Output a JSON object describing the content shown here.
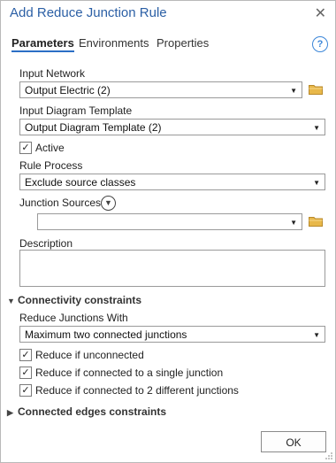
{
  "window": {
    "title": "Add Reduce Junction Rule"
  },
  "tabs": [
    "Parameters",
    "Environments",
    "Properties"
  ],
  "fields": {
    "input_network": {
      "label": "Input Network",
      "value": "Output Electric (2)"
    },
    "input_diagram_template": {
      "label": "Input Diagram Template",
      "value": "Output Diagram Template (2)"
    },
    "active": {
      "label": "Active",
      "checked": true
    },
    "rule_process": {
      "label": "Rule Process",
      "value": "Exclude source classes"
    },
    "junction_sources": {
      "label": "Junction Sources",
      "value": ""
    },
    "description": {
      "label": "Description",
      "value": ""
    }
  },
  "connectivity": {
    "title": "Connectivity constraints",
    "reduce_with": {
      "label": "Reduce Junctions With",
      "value": "Maximum two connected junctions"
    },
    "checkboxes": [
      {
        "label": "Reduce if unconnected",
        "checked": true
      },
      {
        "label": "Reduce if connected to a single junction",
        "checked": true
      },
      {
        "label": "Reduce if connected to 2 different junctions",
        "checked": true
      }
    ]
  },
  "connected_edges": {
    "title": "Connected edges constraints"
  },
  "buttons": {
    "ok": "OK"
  },
  "icons": {
    "close": "close-icon",
    "help": "help-icon",
    "folder": "folder-icon",
    "dropdown": "chevron-down-icon",
    "expand": "chevron-circle-down-icon",
    "section_collapse": "chevron-down-icon",
    "section_expand": "chevron-right-icon"
  },
  "colors": {
    "accent": "#2b6fc5",
    "title": "#2b5fa5",
    "folder": "#e8b84a"
  }
}
